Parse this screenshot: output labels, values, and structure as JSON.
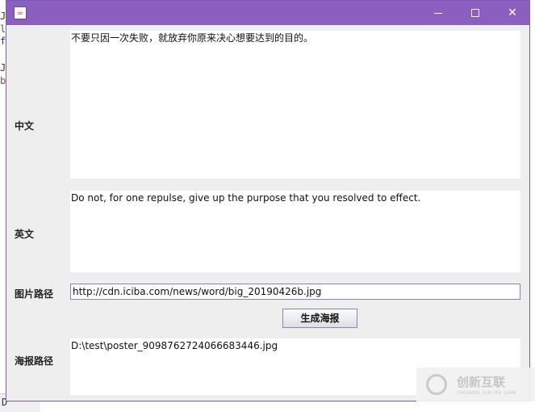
{
  "background_app": {
    "chars": [
      "J",
      "lb",
      "fi",
      "J",
      "b",
      "D"
    ]
  },
  "window": {
    "title_icon": "java-icon",
    "controls": {
      "minimize": "minimize-icon",
      "maximize": "maximize-icon",
      "close_glyph": "✕"
    }
  },
  "form": {
    "chinese_label": "中文",
    "chinese_text": "不要只因一次失败，就放弃你原来决心想要达到的目的。",
    "english_label": "英文",
    "english_text": "Do not, for one repulse, give up the purpose that you resolved to effect.",
    "image_path_label": "图片路径",
    "image_path_value": "http://cdn.iciba.com/news/word/big_20190426b.jpg",
    "generate_button": "生成海报",
    "poster_path_label": "海报路径",
    "poster_path_text": "D:\\test\\poster_9098762724066683446.jpg"
  },
  "watermark": {
    "text": "创新互联",
    "subtext": "CHUANG XIN HU LIAN"
  },
  "colors": {
    "titlebar": "#8a5fbf",
    "window_bg": "#eeeeee"
  }
}
